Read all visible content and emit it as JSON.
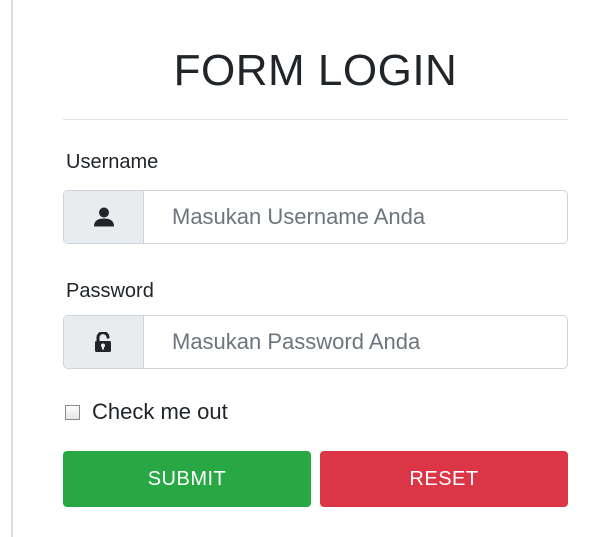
{
  "form": {
    "title": "FORM LOGIN",
    "username": {
      "label": "Username",
      "icon": "user-icon",
      "placeholder": "Masukan Username Anda",
      "value": ""
    },
    "password": {
      "label": "Password",
      "icon": "unlock-icon",
      "placeholder": "Masukan Password Anda",
      "value": ""
    },
    "checkbox": {
      "label": "Check me out",
      "checked": false
    },
    "buttons": {
      "submit_label": "SUBMIT",
      "reset_label": "RESET"
    }
  },
  "colors": {
    "submit": "#28a745",
    "reset": "#dc3545",
    "addon_bg": "#e9ecef",
    "border": "#ced4da"
  }
}
